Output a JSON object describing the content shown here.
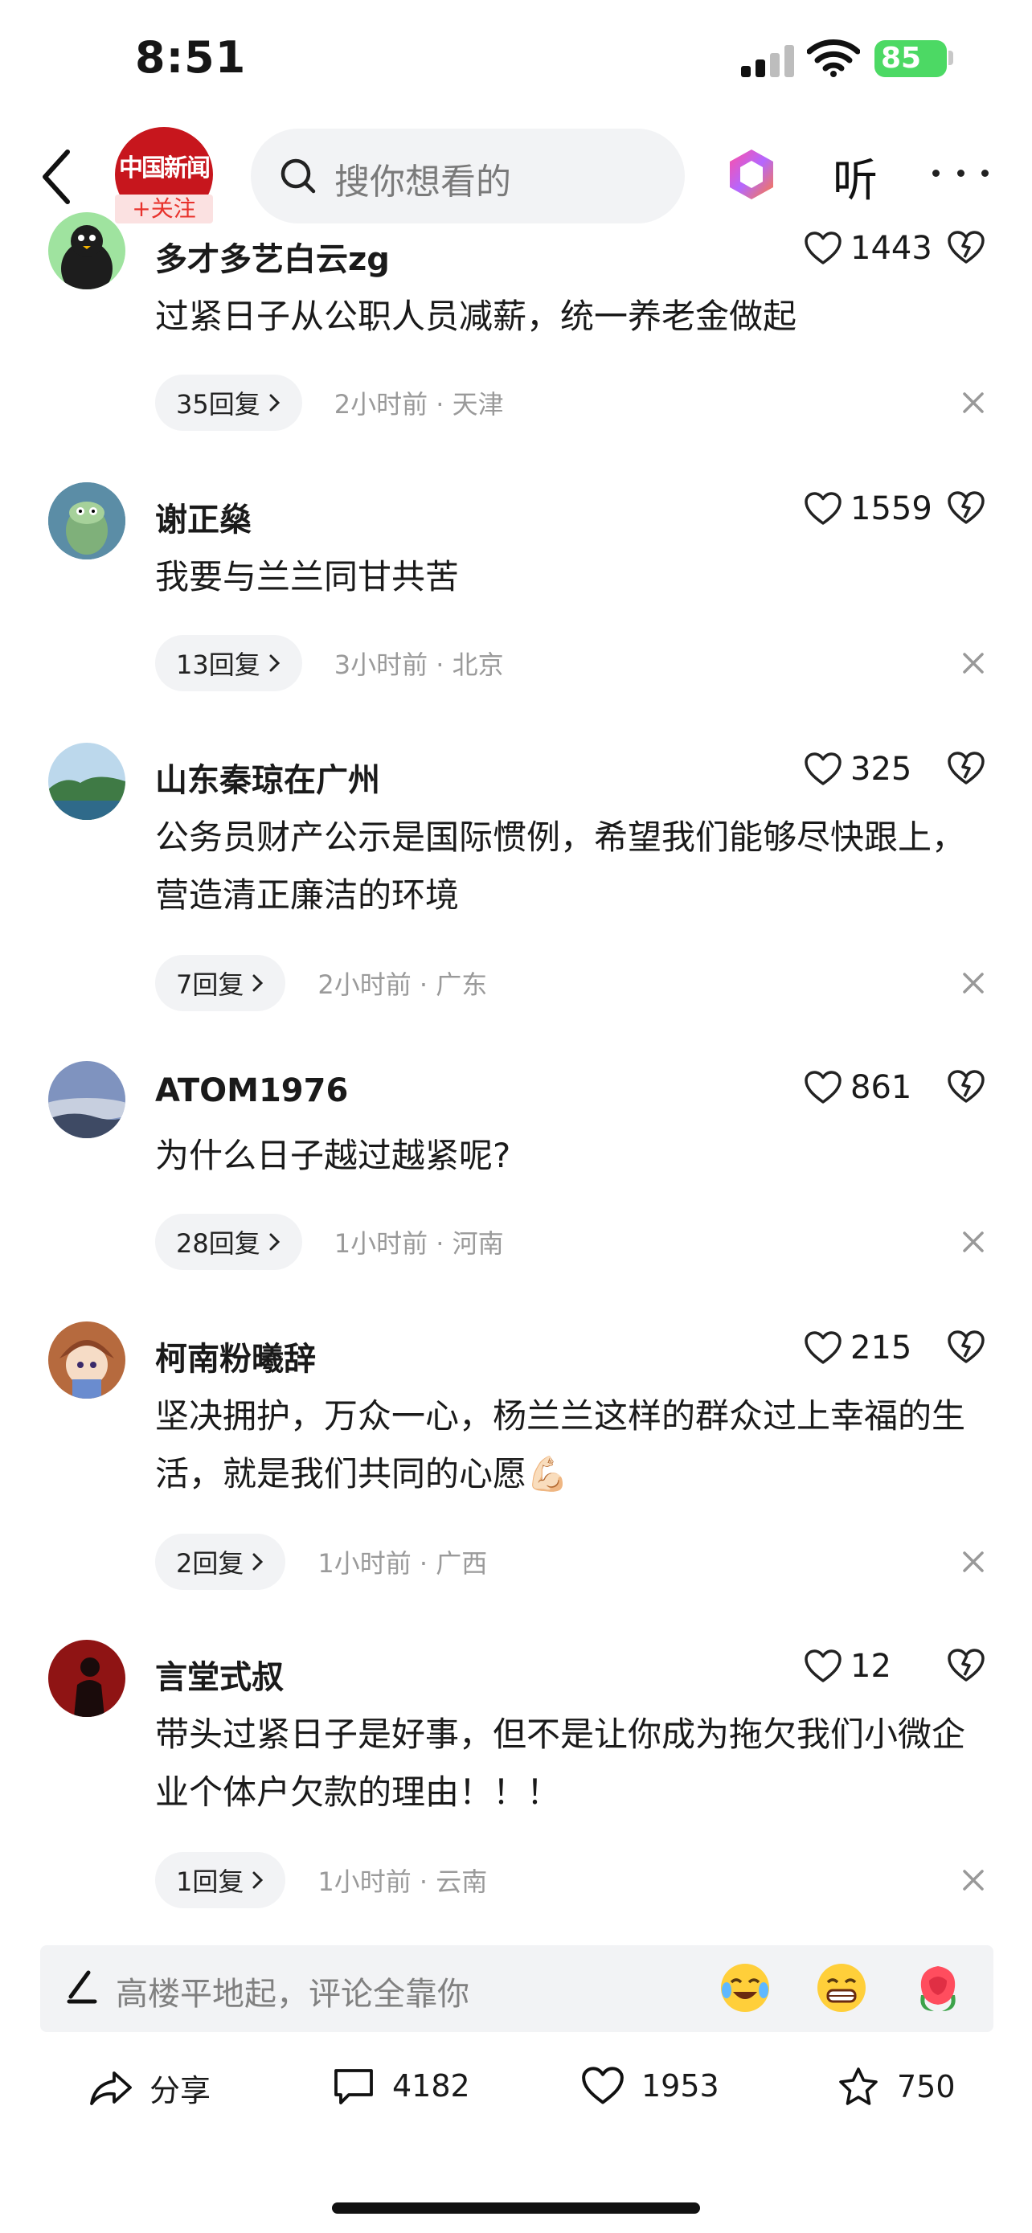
{
  "status_bar": {
    "time": "8:51",
    "battery": "85"
  },
  "header": {
    "logo_text": "中国新闻",
    "follow_label": "+关注",
    "search_placeholder": "搜你想看的",
    "listen_label": "听"
  },
  "comments": [
    {
      "user": "多才多艺白云zg",
      "likes": "1443",
      "text": "过紧日子从公职人员减薪，统一养老金做起",
      "replies": "35回复",
      "time_loc": "2小时前 · 天津"
    },
    {
      "user": "谢正燊",
      "likes": "1559",
      "text": "我要与兰兰同甘共苦",
      "replies": "13回复",
      "time_loc": "3小时前 · 北京"
    },
    {
      "user": "山东秦琼在广州",
      "likes": "325",
      "text": "公务员财产公示是国际惯例，希望我们能够尽快跟上，营造清正廉洁的环境",
      "replies": "7回复",
      "time_loc": "2小时前 · 广东"
    },
    {
      "user": "ATOM1976",
      "likes": "861",
      "text": "为什么日子越过越紧呢?",
      "replies": "28回复",
      "time_loc": "1小时前 · 河南"
    },
    {
      "user": "柯南粉曦辞",
      "likes": "215",
      "text": "坚决拥护，万众一心，杨兰兰这样的群众过上幸福的生活，就是我们共同的心愿💪🏻",
      "replies": "2回复",
      "time_loc": "1小时前 · 广西"
    },
    {
      "user": "言堂式叔",
      "likes": "12",
      "text": "带头过紧日子是好事，但不是让你成为拖欠我们小微企业个体户欠款的理由！！！",
      "replies": "1回复",
      "time_loc": "1小时前 · 云南"
    }
  ],
  "input": {
    "placeholder": "高楼平地起，评论全靠你"
  },
  "actions": {
    "share": "分享",
    "comments": "4182",
    "likes": "1953",
    "favorites": "750"
  }
}
